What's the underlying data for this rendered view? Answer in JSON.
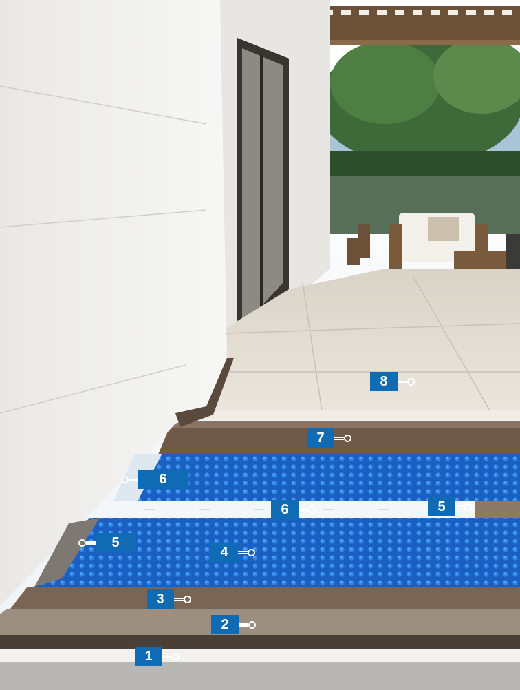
{
  "callouts": [
    {
      "label": "8",
      "name": "callout-8"
    },
    {
      "label": "7",
      "name": "callout-7"
    },
    {
      "label": "6",
      "name": "callout-6-left"
    },
    {
      "label": "6",
      "name": "callout-6-center"
    },
    {
      "label": "5",
      "name": "callout-5-right"
    },
    {
      "label": "5",
      "name": "callout-5-left"
    },
    {
      "label": "4",
      "name": "callout-4"
    },
    {
      "label": "3",
      "name": "callout-3"
    },
    {
      "label": "2",
      "name": "callout-2"
    },
    {
      "label": "1",
      "name": "callout-1"
    }
  ]
}
